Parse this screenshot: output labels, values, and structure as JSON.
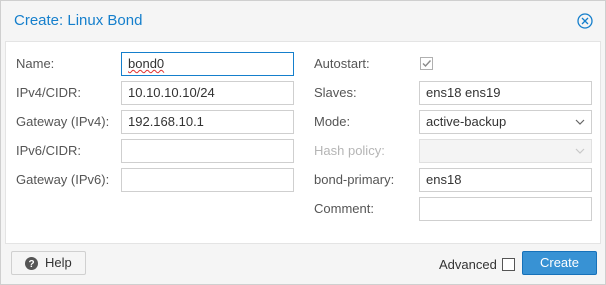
{
  "dialog": {
    "title": "Create: Linux Bond"
  },
  "left": {
    "name_label": "Name:",
    "name_value": "bond0",
    "ipv4_label": "IPv4/CIDR:",
    "ipv4_value": "10.10.10.10/24",
    "gw4_label": "Gateway (IPv4):",
    "gw4_value": "192.168.10.1",
    "ipv6_label": "IPv6/CIDR:",
    "ipv6_value": "",
    "gw6_label": "Gateway (IPv6):",
    "gw6_value": ""
  },
  "right": {
    "autostart_label": "Autostart:",
    "autostart_checked": true,
    "slaves_label": "Slaves:",
    "slaves_value": "ens18 ens19",
    "mode_label": "Mode:",
    "mode_value": "active-backup",
    "hash_label": "Hash policy:",
    "hash_value": "",
    "primary_label": "bond-primary:",
    "primary_value": "ens18",
    "comment_label": "Comment:",
    "comment_value": ""
  },
  "footer": {
    "help_label": "Help",
    "advanced_label": "Advanced",
    "advanced_checked": false,
    "create_label": "Create"
  },
  "colors": {
    "accent": "#157fcc",
    "primary_button": "#3892d4"
  }
}
